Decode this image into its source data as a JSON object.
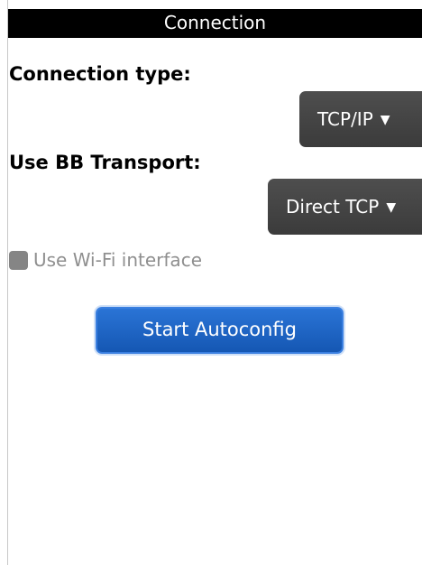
{
  "title_bar": {
    "title": "Connection"
  },
  "form": {
    "connection_type": {
      "label": "Connection type:",
      "selected": "TCP/IP"
    },
    "bb_transport": {
      "label": "Use BB Transport:",
      "selected": "Direct TCP"
    },
    "wifi": {
      "label": "Use Wi-Fi interface",
      "checked": false,
      "enabled": false
    }
  },
  "actions": {
    "start_autoconfig": "Start Autoconfig"
  }
}
